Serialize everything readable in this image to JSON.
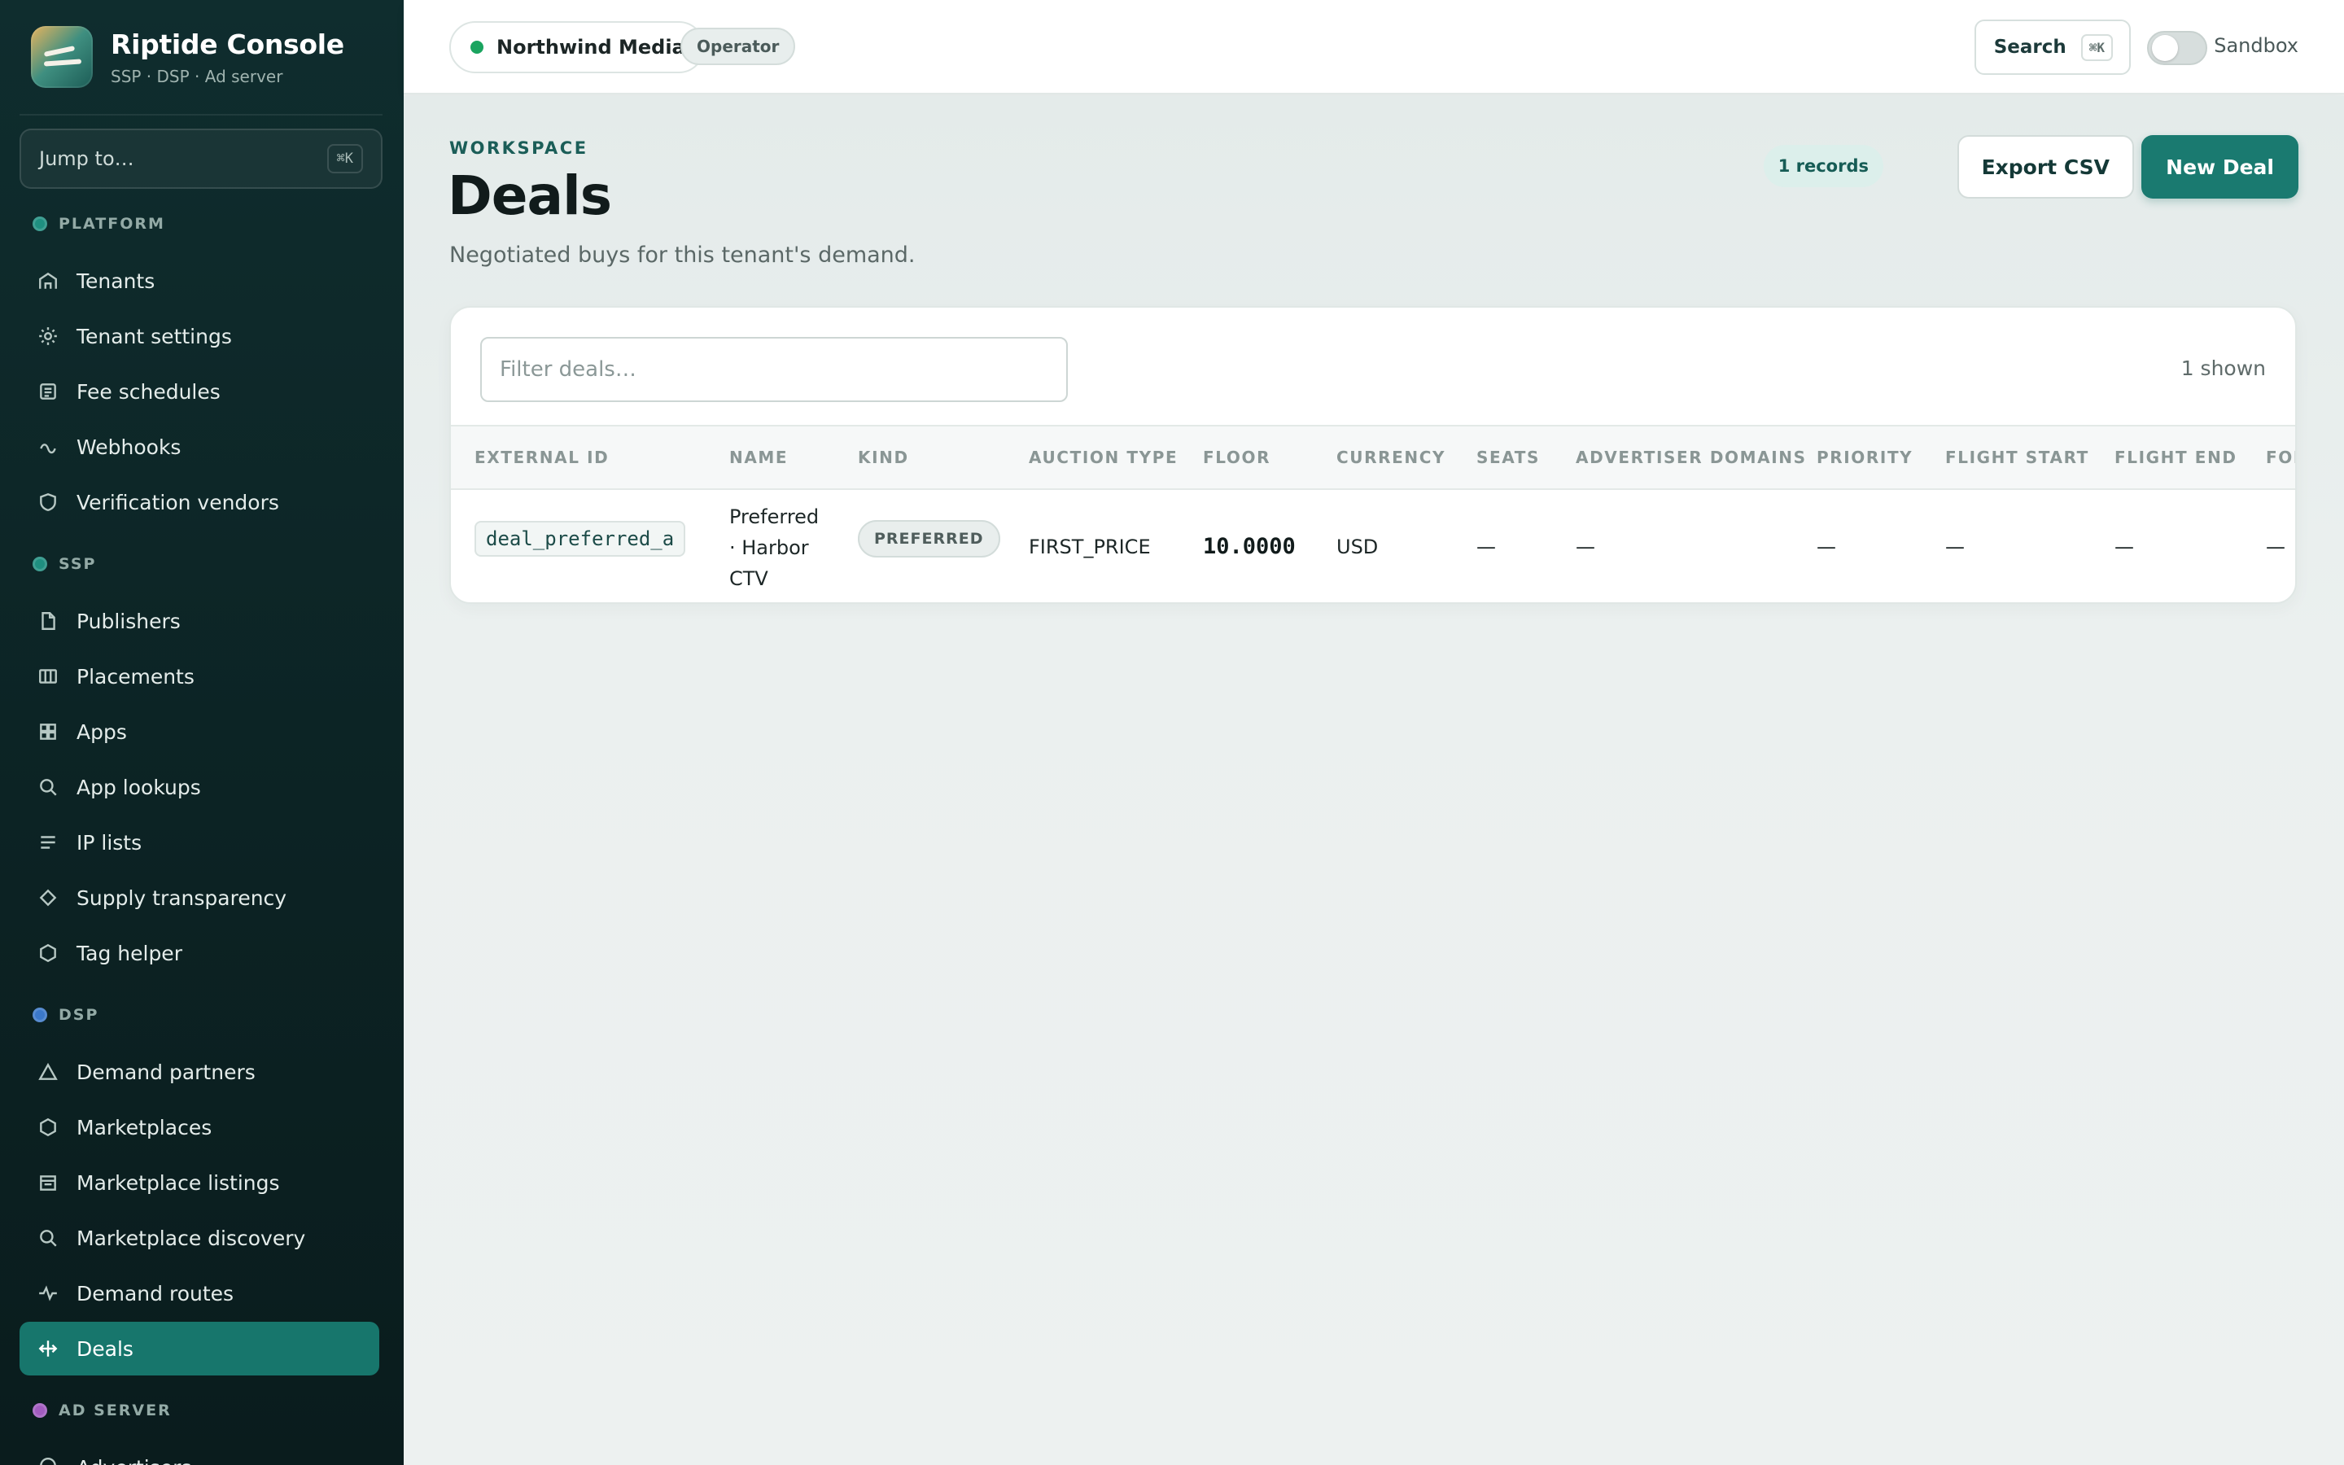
{
  "brand": {
    "title": "Riptide Console",
    "subtitle": "SSP · DSP · Ad server"
  },
  "jump": {
    "label": "Jump to…",
    "shortcut": "⌘K"
  },
  "sections": {
    "platform": {
      "label": "PLATFORM",
      "color": "#1f8f80",
      "items": [
        "Tenants",
        "Tenant settings",
        "Fee schedules",
        "Webhooks",
        "Verification vendors"
      ]
    },
    "ssp": {
      "label": "SSP",
      "color": "#1f8f80",
      "items": [
        "Publishers",
        "Placements",
        "Apps",
        "App lookups",
        "IP lists",
        "Supply transparency",
        "Tag helper"
      ]
    },
    "dsp": {
      "label": "DSP",
      "color": "#3b78c9",
      "items": [
        "Demand partners",
        "Marketplaces",
        "Marketplace listings",
        "Marketplace discovery",
        "Demand routes",
        "Deals"
      ]
    },
    "adserver": {
      "label": "AD SERVER",
      "color": "#a25cc0",
      "items": [
        "Advertisers"
      ]
    }
  },
  "active_nav": "Deals",
  "topbar": {
    "tenant": "Northwind Media",
    "role": "Operator",
    "search_label": "Search",
    "search_shortcut": "⌘K",
    "sandbox_label": "Sandbox",
    "sandbox_on": false
  },
  "page": {
    "eyebrow": "WORKSPACE",
    "title": "Deals",
    "subtitle": "Negotiated buys for this tenant's demand.",
    "records_badge": "1 records",
    "export_label": "Export CSV",
    "new_label": "New Deal"
  },
  "table": {
    "filter_placeholder": "Filter deals…",
    "shown": "1 shown",
    "columns": [
      "EXTERNAL ID",
      "NAME",
      "KIND",
      "AUCTION TYPE",
      "FLOOR",
      "CURRENCY",
      "SEATS",
      "ADVERTISER DOMAINS",
      "PRIORITY",
      "FLIGHT START",
      "FLIGHT END",
      "FOR"
    ],
    "rows": [
      {
        "external_id": "deal_preferred_a",
        "name": "Preferred · Harbor CTV",
        "kind": "PREFERRED",
        "auction_type": "FIRST_PRICE",
        "floor": "10.0000",
        "currency": "USD",
        "seats": "—",
        "advertiser_domains": "—",
        "priority": "—",
        "flight_start": "—",
        "flight_end": "—",
        "for": "—"
      }
    ]
  },
  "colors": {
    "accent": "#1a7a70",
    "sidebar_bg": "#0f2d2e",
    "live_dot": "#1aa45f"
  }
}
